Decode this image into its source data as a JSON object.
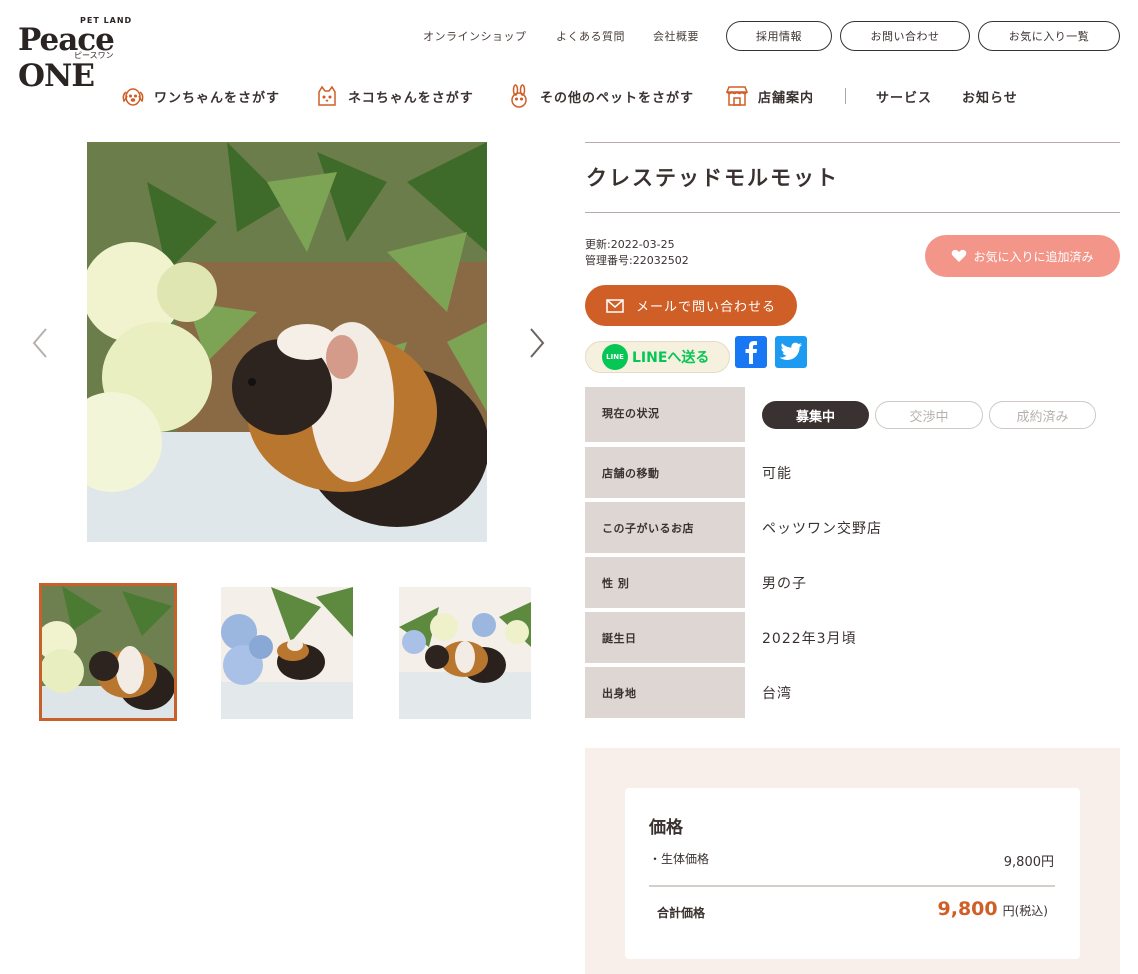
{
  "header": {
    "logo": {
      "brand": "Peace ONE",
      "tag": "PET LAND",
      "kana": "ピースワン"
    },
    "links": [
      "オンラインショップ",
      "よくある質問",
      "会社概要"
    ],
    "buttons": [
      "採用情報",
      "お問い合わせ",
      "お気に入り一覧"
    ]
  },
  "nav": {
    "items": [
      "ワンちゃんをさがす",
      "ネコちゃんをさがす",
      "その他のペットをさがす",
      "店舗案内",
      "サービス",
      "お知らせ"
    ]
  },
  "product": {
    "name": "クレステッドモルモット",
    "updated": "更新:2022-03-25",
    "id": "管理番号:22032502",
    "favorite_label": "お気に入りに追加済み",
    "mail_label": "メールで問い合わせる",
    "line_label": "LINEへ送る",
    "line_badge": "LINE"
  },
  "details": {
    "status_label": "現在の状況",
    "statuses": [
      "募集中",
      "交渉中",
      "成約済み"
    ],
    "active_status": "募集中",
    "rows": [
      {
        "label": "店舗の移動",
        "value": "可能"
      },
      {
        "label": "この子がいるお店",
        "value": "ペッツワン交野店"
      },
      {
        "label": "性 別",
        "value": "男の子"
      },
      {
        "label": "誕生日",
        "value": "2022年3月頃"
      },
      {
        "label": "出身地",
        "value": "台湾"
      }
    ]
  },
  "price": {
    "heading": "価格",
    "item_label": "・生体価格",
    "item_value": "9,800円",
    "total_label": "合計価格",
    "total_value": "9,800",
    "total_unit": "円(税込)"
  },
  "colors": {
    "accent": "#cf5e27",
    "favorite": "#f39689",
    "table_label_bg": "#ded6d3",
    "price_bg": "#f8eeea"
  },
  "icons": [
    "dog-icon",
    "cat-icon",
    "rabbit-icon",
    "shop-icon",
    "heart-icon",
    "mail-icon",
    "facebook-icon",
    "twitter-icon",
    "chevron-left-icon",
    "chevron-right-icon"
  ]
}
